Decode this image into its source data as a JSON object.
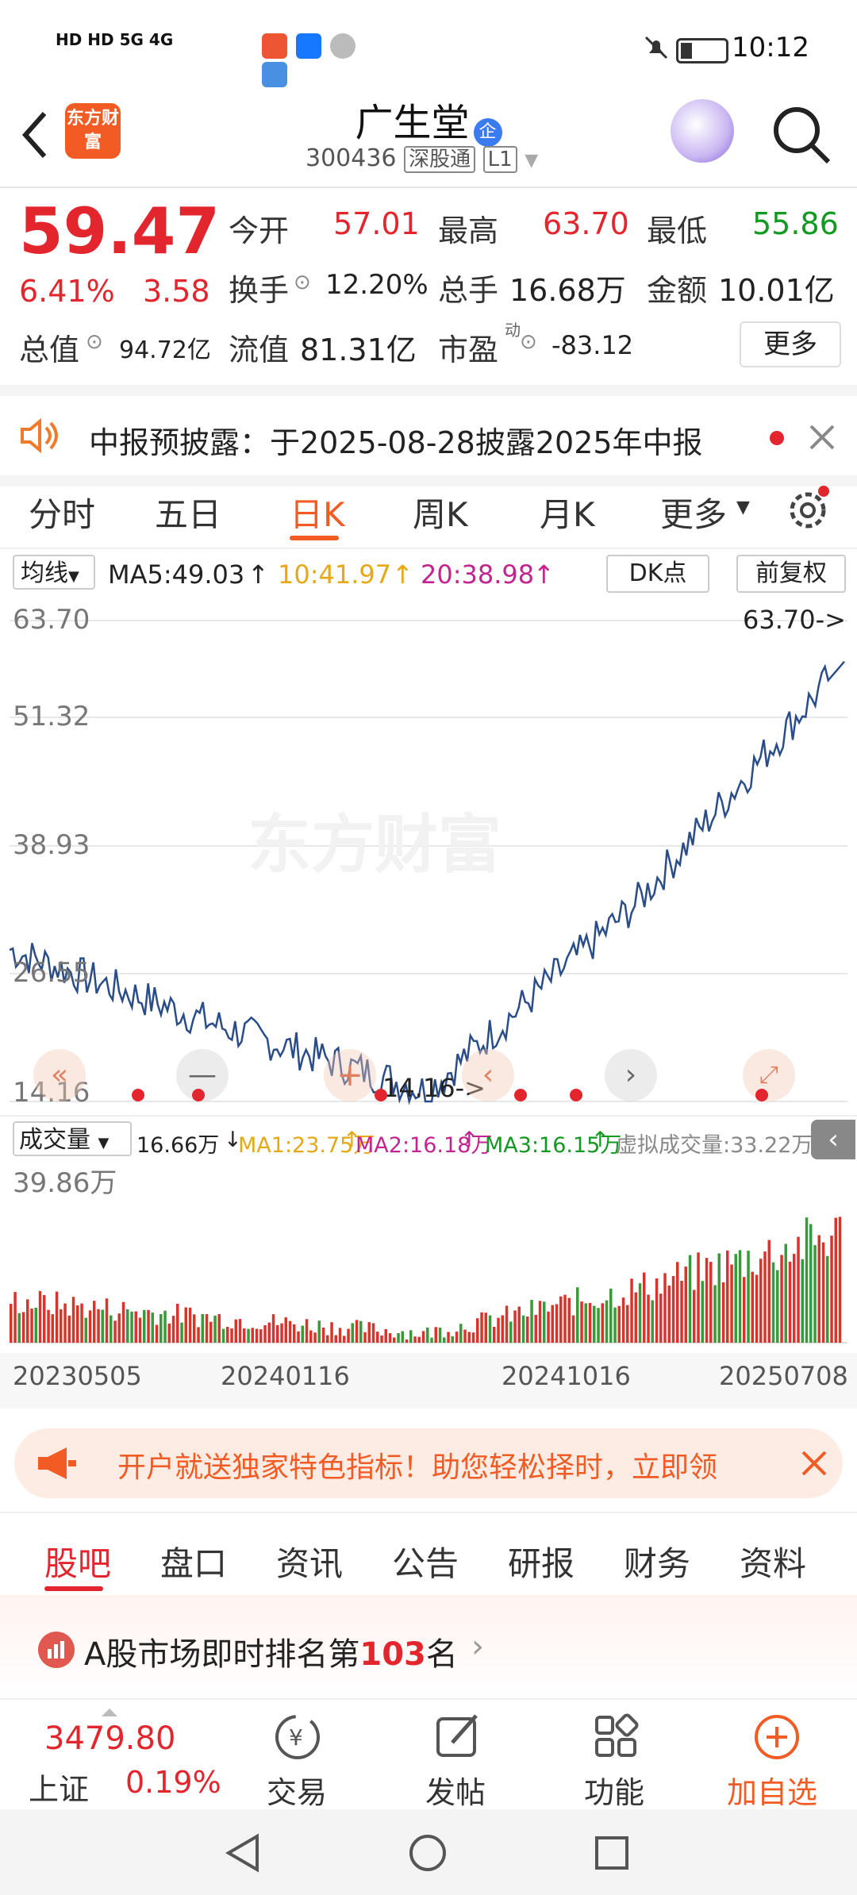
{
  "status_bar": {
    "left_icons": "HD HD 5G 4G",
    "time": "10:12"
  },
  "header": {
    "app_logo": "东方财富",
    "stock_name": "广生堂",
    "badge": "企",
    "code": "300436",
    "exchange": "深股通",
    "level": "L1"
  },
  "quote": {
    "price": "59.47",
    "change_pct": "6.41%",
    "change_amt": "3.58",
    "open_label": "今开",
    "open": "57.01",
    "high_label": "最高",
    "high": "63.70",
    "low_label": "最低",
    "low": "55.86",
    "turnover_label": "换手",
    "turnover": "12.20%",
    "volume_label": "总手",
    "volume": "16.68万",
    "amount_label": "金额",
    "amount": "10.01亿",
    "mktcap_label": "总值",
    "mktcap": "94.72亿",
    "float_label": "流值",
    "float": "81.31亿",
    "pe_label": "市盈",
    "pe_sup": "动",
    "pe": "-83.12",
    "more_button": "更多"
  },
  "notice": {
    "text": "中报预披露：于2025-08-28披露2025年中报"
  },
  "chart_tabs": {
    "items": [
      "分时",
      "五日",
      "日K",
      "周K",
      "月K",
      "更多"
    ],
    "active": "日K"
  },
  "ma_bar": {
    "dropdown": "均线",
    "ma5": "MA5:49.03",
    "ma10": "10:41.97",
    "ma20": "20:38.98",
    "dk": "DK点",
    "adjust": "前复权"
  },
  "price_chart": {
    "ticks": [
      "63.70",
      "51.32",
      "38.93",
      "26.55",
      "14.16"
    ],
    "high_marker": "63.70->",
    "low_marker": "14.16->",
    "watermark": "东方财富",
    "colors": {
      "line": "#2a4d8a",
      "up": "#e3262d",
      "down": "#119922"
    }
  },
  "volume_bar": {
    "dropdown": "成交量",
    "vol": "16.66万",
    "ma1": "MA1:23.75万",
    "ma2": "MA2:16.18万",
    "ma3": "MA3:16.15万",
    "virtual": "虚拟成交量:33.22万",
    "max_label": "39.86万"
  },
  "x_axis": [
    "20230505",
    "20240116",
    "20241016",
    "20250708"
  ],
  "chart_data": {
    "type": "line",
    "title": "",
    "xlabel": "",
    "ylabel": "",
    "ylim": [
      14.16,
      63.7
    ],
    "x": [
      "20230505",
      "20240116",
      "20241016",
      "20250708"
    ],
    "series": [
      {
        "values": [
          29.8,
          22.0,
          15.2,
          34.5,
          59.47
        ]
      }
    ]
  },
  "banner": {
    "text": "开户就送独家特色指标！助您轻松择时，立即领"
  },
  "bottom_tabs": {
    "items": [
      "股吧",
      "盘口",
      "资讯",
      "公告",
      "研报",
      "财务",
      "资料"
    ],
    "active": "股吧"
  },
  "rank": {
    "prefix": "A股市场即时排名第",
    "number": "103",
    "suffix": "名"
  },
  "bottom_nav": {
    "index_value": "3479.80",
    "index_name": "上证",
    "index_change": "0.19%",
    "items": [
      "交易",
      "发帖",
      "功能",
      "加自选"
    ]
  }
}
